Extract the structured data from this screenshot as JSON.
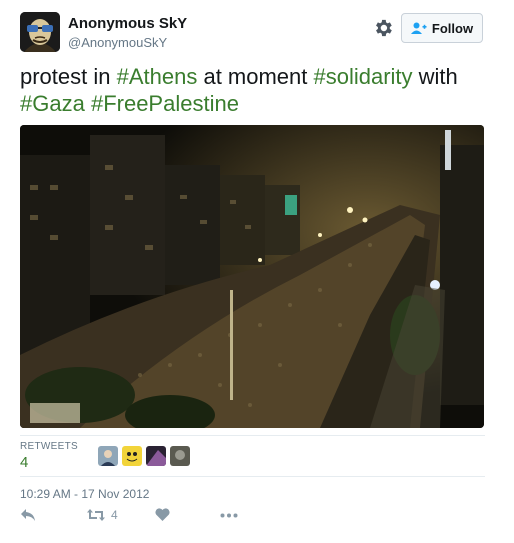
{
  "user": {
    "name": "Anonymous SkY",
    "handle": "@AnonymouSkY"
  },
  "follow_label": "Follow",
  "tweet": {
    "parts": [
      {
        "text": "protest in ",
        "hashtag": false
      },
      {
        "text": "#Athens",
        "hashtag": true
      },
      {
        "text": " at moment ",
        "hashtag": false
      },
      {
        "text": "#solidarity",
        "hashtag": true
      },
      {
        "text": " with ",
        "hashtag": false
      },
      {
        "text": "#Gaza",
        "hashtag": true
      },
      {
        "text": " ",
        "hashtag": false
      },
      {
        "text": "#FreePalestine",
        "hashtag": true
      }
    ]
  },
  "stats": {
    "retweets_label": "RETWEETS",
    "retweets_value": "4"
  },
  "timestamp": "10:29 AM - 17 Nov 2012",
  "actions": {
    "retweet_count": "4"
  },
  "colors": {
    "hashtag": "#3a7d2e",
    "text": "#14171a",
    "muted": "#657786"
  },
  "icons": [
    "gear-icon",
    "follow-person-icon",
    "reply-icon",
    "retweet-icon",
    "like-icon",
    "more-icon"
  ]
}
